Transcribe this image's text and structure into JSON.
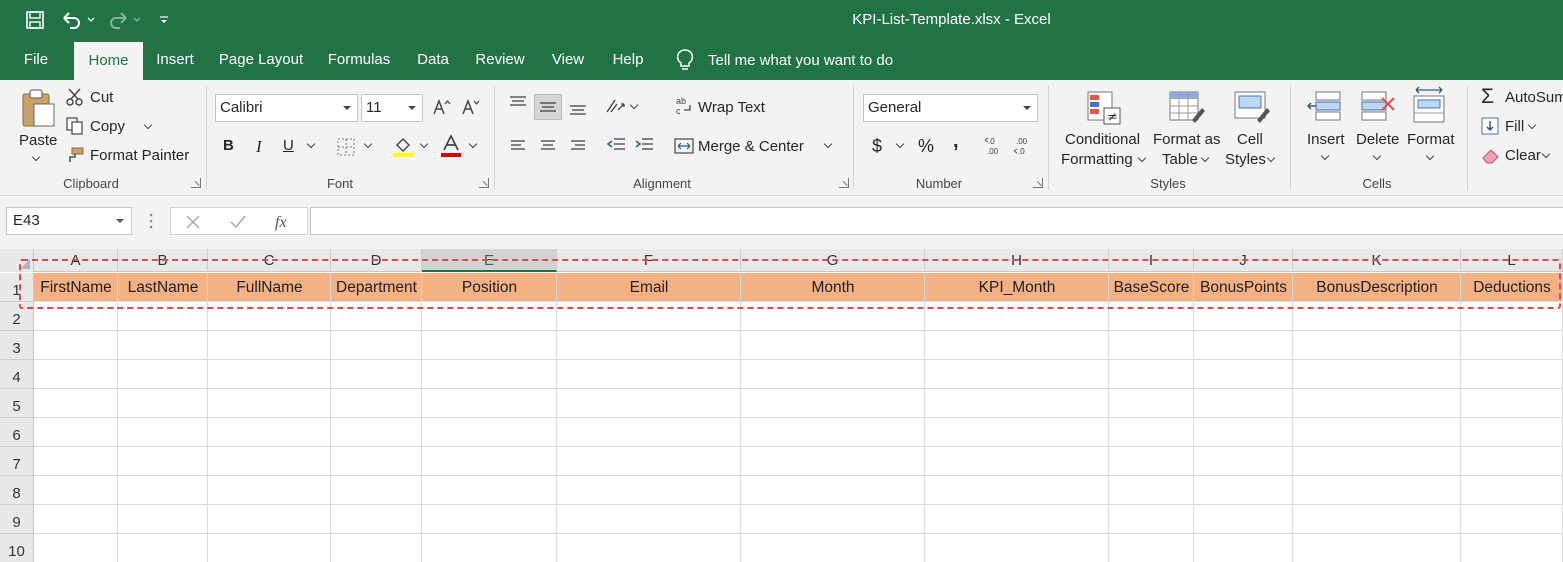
{
  "window": {
    "title": "KPI-List-Template.xlsx  -  Excel"
  },
  "tabs": [
    {
      "label": "File"
    },
    {
      "label": "Home"
    },
    {
      "label": "Insert"
    },
    {
      "label": "Page Layout"
    },
    {
      "label": "Formulas"
    },
    {
      "label": "Data"
    },
    {
      "label": "Review"
    },
    {
      "label": "View"
    },
    {
      "label": "Help"
    }
  ],
  "tell_me": "Tell me what you want to do",
  "ribbon": {
    "clipboard": {
      "paste": "Paste",
      "cut": "Cut",
      "copy": "Copy",
      "format_painter": "Format Painter",
      "label": "Clipboard"
    },
    "font": {
      "font_name": "Calibri",
      "font_size": "11",
      "bold": "B",
      "italic": "I",
      "underline": "U",
      "label": "Font"
    },
    "alignment": {
      "wrap_text": "Wrap Text",
      "merge_center": "Merge & Center",
      "label": "Alignment"
    },
    "number": {
      "format": "General",
      "currency": "$",
      "percent": "%",
      "comma": ",",
      "label": "Number"
    },
    "styles": {
      "conditional_1": "Conditional",
      "conditional_2": "Formatting",
      "format_table_1": "Format as",
      "format_table_2": "Table",
      "cell_styles_1": "Cell",
      "cell_styles_2": "Styles",
      "label": "Styles"
    },
    "cells": {
      "insert": "Insert",
      "delete": "Delete",
      "format": "Format",
      "label": "Cells"
    },
    "editing": {
      "autosum": "AutoSum",
      "fill": "Fill",
      "clear": "Clear"
    }
  },
  "formula_bar": {
    "name_box": "E43",
    "formula": ""
  },
  "sheet": {
    "columns": [
      "A",
      "B",
      "C",
      "D",
      "E",
      "F",
      "G",
      "H",
      "I",
      "J",
      "K",
      "L"
    ],
    "selected_column": "E",
    "rows": [
      "1",
      "2",
      "3",
      "4",
      "5",
      "6",
      "7",
      "8",
      "9",
      "10"
    ],
    "header_row": [
      "FirstName",
      "LastName",
      "FullName",
      "Department",
      "Position",
      "Email",
      "Month",
      "KPI_Month",
      "BaseScore",
      "BonusPoints",
      "BonusDescription",
      "Deductions"
    ],
    "header_fill": "#f4b183",
    "highlight_color": "#e5484d"
  },
  "colors": {
    "excel_green": "#217346"
  }
}
